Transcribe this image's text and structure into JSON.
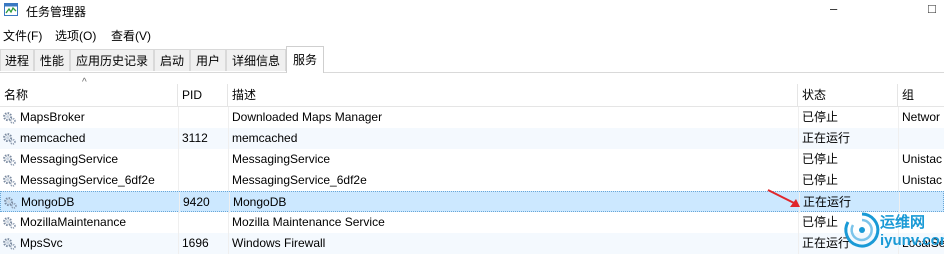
{
  "window": {
    "title": "任务管理器",
    "controls": {
      "minimize": "–",
      "restore": "□"
    }
  },
  "menu": [
    {
      "label": "文件(F)"
    },
    {
      "label": "选项(O)"
    },
    {
      "label": "查看(V)"
    }
  ],
  "tabs": [
    {
      "label": "进程",
      "active": false
    },
    {
      "label": "性能",
      "active": false
    },
    {
      "label": "应用历史记录",
      "active": false
    },
    {
      "label": "启动",
      "active": false
    },
    {
      "label": "用户",
      "active": false
    },
    {
      "label": "详细信息",
      "active": false
    },
    {
      "label": "服务",
      "active": true
    }
  ],
  "columns": [
    {
      "label": "名称"
    },
    {
      "label": "PID"
    },
    {
      "label": "描述"
    },
    {
      "label": "状态"
    },
    {
      "label": "组"
    }
  ],
  "sort_indicator": "^",
  "rows": [
    {
      "name": "MapsBroker",
      "pid": "",
      "desc": "Downloaded Maps Manager",
      "status": "已停止",
      "group": "Networ",
      "selected": false
    },
    {
      "name": "memcached",
      "pid": "3112",
      "desc": "memcached",
      "status": "正在运行",
      "group": "",
      "selected": false
    },
    {
      "name": "MessagingService",
      "pid": "",
      "desc": "MessagingService",
      "status": "已停止",
      "group": "Unistac",
      "selected": false
    },
    {
      "name": "MessagingService_6df2e",
      "pid": "",
      "desc": "MessagingService_6df2e",
      "status": "已停止",
      "group": "Unistac",
      "selected": false
    },
    {
      "name": "MongoDB",
      "pid": "9420",
      "desc": "MongoDB",
      "status": "正在运行",
      "group": "",
      "selected": true
    },
    {
      "name": "MozillaMaintenance",
      "pid": "",
      "desc": "Mozilla Maintenance Service",
      "status": "已停止",
      "group": "",
      "selected": false
    },
    {
      "name": "MpsSvc",
      "pid": "1696",
      "desc": "Windows Firewall",
      "status": "正在运行",
      "group": "LocalSe",
      "selected": false
    }
  ],
  "watermark": {
    "cn": "运维网",
    "en": "iyunv.com"
  },
  "colors": {
    "selection": "#cce8ff",
    "annotation_arrow": "#e0262b",
    "watermark": "#1a9ad6"
  }
}
